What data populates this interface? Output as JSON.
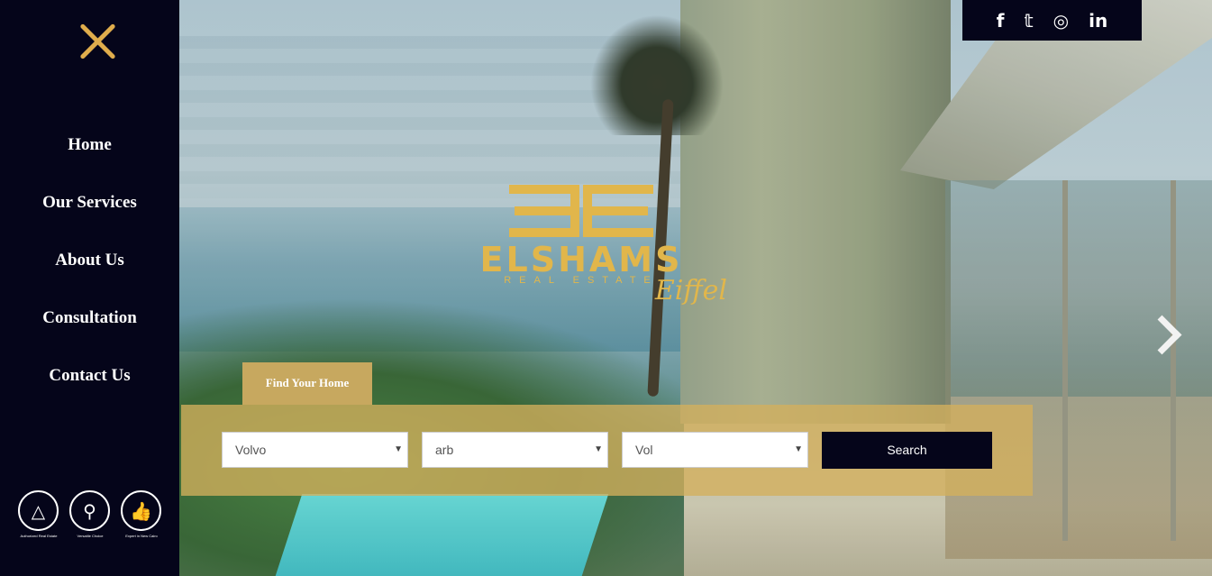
{
  "sidebar": {
    "nav": [
      {
        "label": "Home"
      },
      {
        "label": "Our Services"
      },
      {
        "label": "About Us"
      },
      {
        "label": "Consultation"
      },
      {
        "label": "Contact Us"
      }
    ],
    "badges": [
      {
        "icon": "pyramids-icon",
        "caption": "Authorized Real Estate"
      },
      {
        "icon": "magnifier-icon",
        "caption": "Versatile Choice"
      },
      {
        "icon": "thumbs-up-icon",
        "caption": "Expert in New Cairo"
      }
    ]
  },
  "social": [
    "f",
    "𝕥",
    "◎",
    "in"
  ],
  "logo": {
    "name": "ELSHAMS",
    "sub": "REAL ESTATE",
    "script": "Eiffel"
  },
  "search": {
    "tab_label": "Find Your Home",
    "selects": [
      "Volvo",
      "arb",
      "Vol"
    ],
    "caret": "▼",
    "button_label": "Search"
  },
  "colors": {
    "gold": "#e0ad4c",
    "navy": "#05051a",
    "panel": "#d4af5c"
  }
}
